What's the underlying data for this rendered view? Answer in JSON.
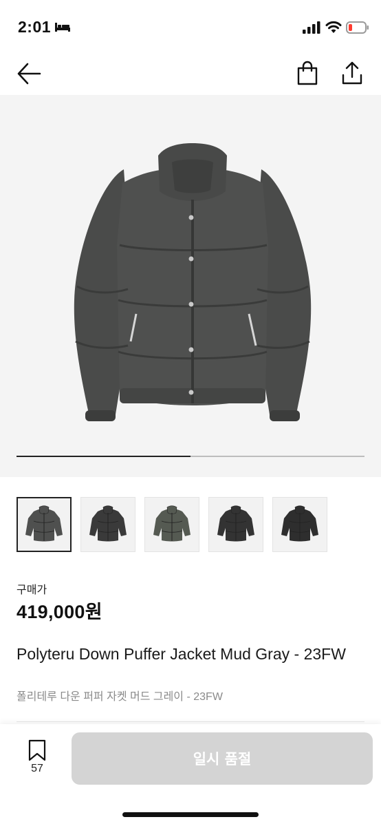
{
  "status_bar": {
    "time": "2:01",
    "icons": [
      "sleep-icon",
      "signal-icon",
      "wifi-icon",
      "battery-low-icon"
    ],
    "battery_color": "#ff3b30"
  },
  "nav": {
    "icons": [
      "back-arrow-icon",
      "shopping-bag-icon",
      "share-icon"
    ]
  },
  "gallery": {
    "progress": 0.5,
    "thumbnail_count": 5,
    "selected_index": 0
  },
  "product": {
    "price_label": "구매가",
    "price": "419,000원",
    "title": "Polyteru Down Puffer Jacket Mud Gray - 23FW",
    "subtitle": "폴리테루 다운 퍼퍼 자켓 머드 그레이 - 23FW"
  },
  "bottom_bar": {
    "bookmark_count": "57",
    "action_label": "일시 품절"
  },
  "colors": {
    "hero_background": "#f4f4f4",
    "button_disabled": "#d4d4d4",
    "text_secondary": "#8a8a8a"
  }
}
